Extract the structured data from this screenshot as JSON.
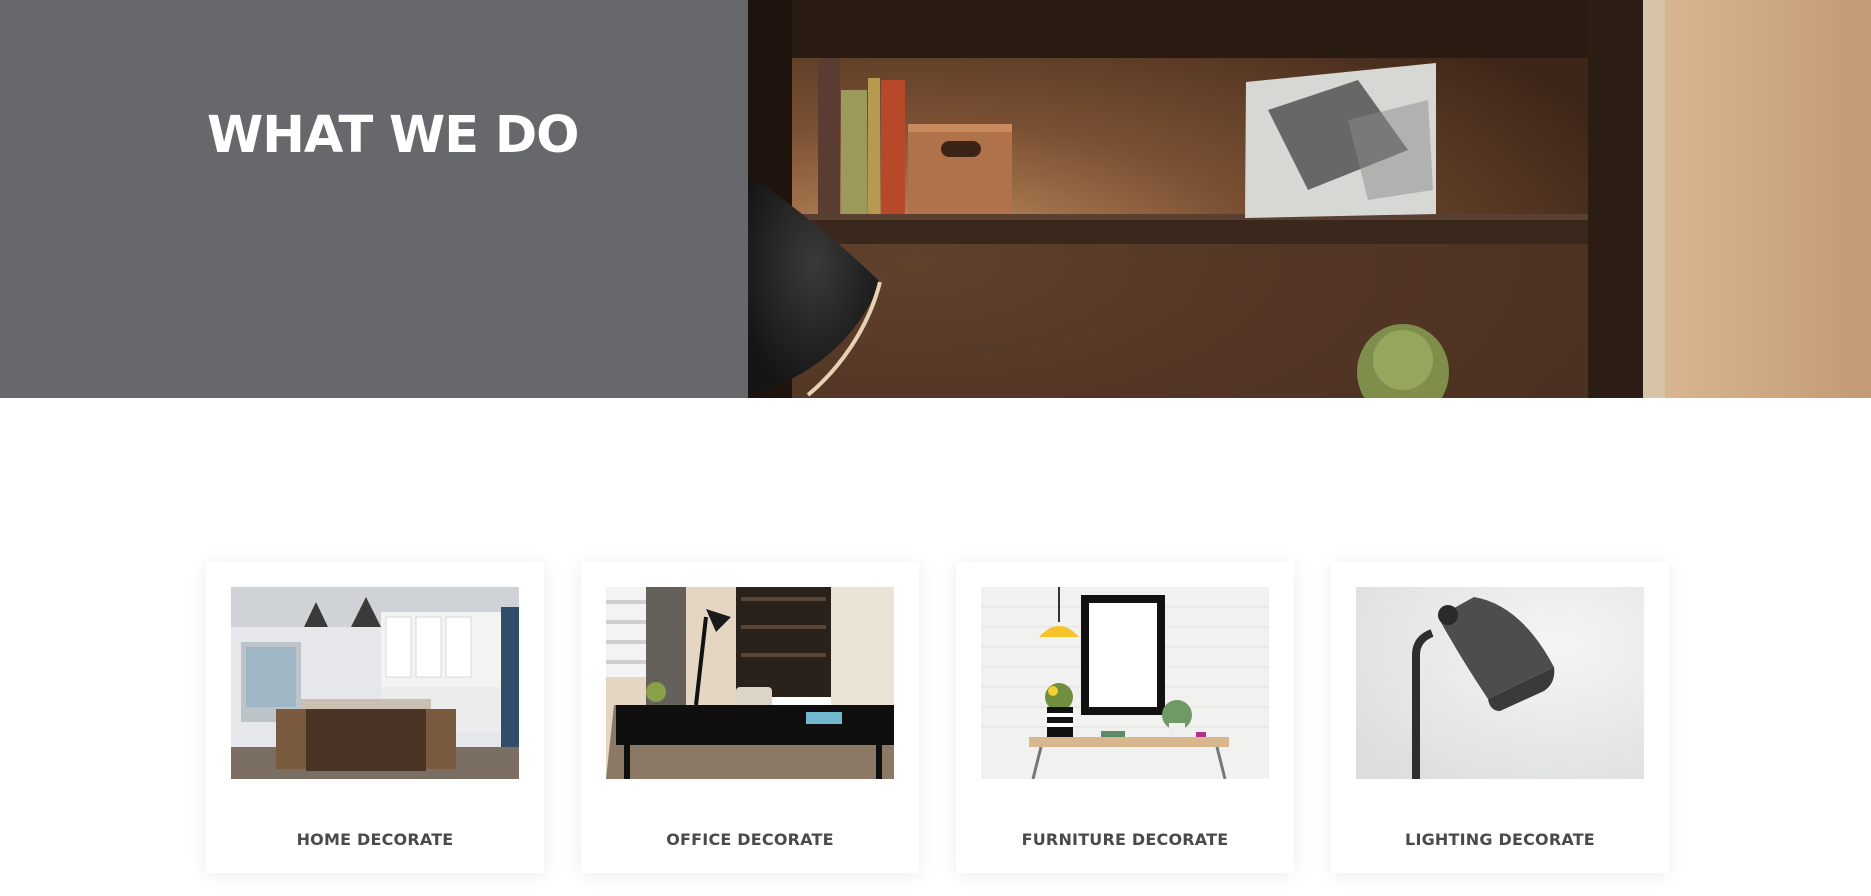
{
  "hero": {
    "title": "WHAT WE DO",
    "panel_color": "#67686c"
  },
  "services": [
    {
      "title": "HOME DECORATE",
      "image": "kitchen-interior-image"
    },
    {
      "title": "OFFICE DECORATE",
      "image": "office-desk-image"
    },
    {
      "title": "FURNITURE DECORATE",
      "image": "furniture-wall-image"
    },
    {
      "title": "LIGHTING DECORATE",
      "image": "desk-lamp-image"
    }
  ]
}
